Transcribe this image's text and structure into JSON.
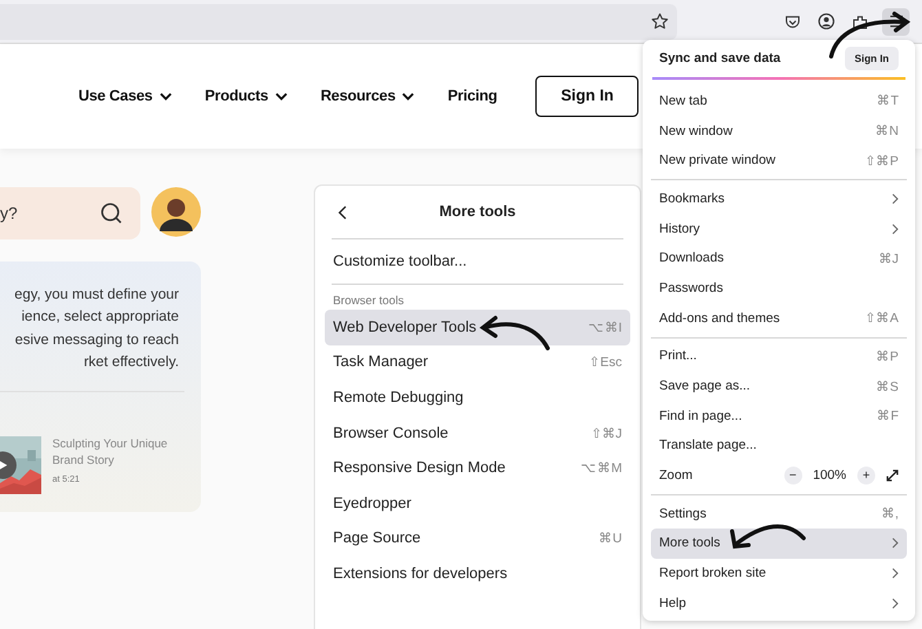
{
  "site_nav": {
    "links": [
      {
        "label": "Use Cases",
        "dropdown": true
      },
      {
        "label": "Products",
        "dropdown": true
      },
      {
        "label": "Resources",
        "dropdown": true
      },
      {
        "label": "Pricing",
        "dropdown": false
      }
    ],
    "sign_in": "Sign In"
  },
  "search": {
    "value": "y?"
  },
  "card": {
    "text": "egy, you must define your\nience, select appropriate\nesive messaging to reach\nrket effectively.",
    "video": {
      "title": "Sculpting Your Unique\nBrand Story",
      "time": "at 5:21"
    }
  },
  "more_tools": {
    "title": "More tools",
    "customize": "Customize toolbar...",
    "section": "Browser tools",
    "items": [
      {
        "label": "Web Developer Tools",
        "shortcut": "⌥⌘I",
        "selected": true
      },
      {
        "label": "Task Manager",
        "shortcut": "⇧Esc",
        "selected": false
      },
      {
        "label": "Remote Debugging",
        "selected": false
      },
      {
        "label": "Browser Console",
        "shortcut": "⇧⌘J",
        "selected": false
      },
      {
        "label": "Responsive Design Mode",
        "shortcut": "⌥⌘M",
        "selected": false
      },
      {
        "label": "Eyedropper",
        "selected": false
      },
      {
        "label": "Page Source",
        "shortcut": "⌘U",
        "selected": false
      },
      {
        "label": "Extensions for developers",
        "selected": false
      }
    ]
  },
  "app_menu": {
    "sync": {
      "title": "Sync and save data",
      "button": "Sign In"
    },
    "groups": [
      [
        {
          "kind": "item",
          "label": "New tab",
          "shortcut": "⌘T",
          "selected": false
        },
        {
          "kind": "item",
          "label": "New window",
          "shortcut": "⌘N",
          "selected": false
        },
        {
          "kind": "item",
          "label": "New private window",
          "shortcut": "⇧⌘P",
          "selected": false
        }
      ],
      [
        {
          "kind": "submenu",
          "label": "Bookmarks",
          "selected": false
        },
        {
          "kind": "submenu",
          "label": "History",
          "selected": false
        },
        {
          "kind": "item",
          "label": "Downloads",
          "shortcut": "⌘J",
          "selected": false
        },
        {
          "kind": "item",
          "label": "Passwords",
          "selected": false
        },
        {
          "kind": "item",
          "label": "Add-ons and themes",
          "shortcut": "⇧⌘A",
          "selected": false
        }
      ],
      [
        {
          "kind": "item",
          "label": "Print...",
          "shortcut": "⌘P",
          "selected": false
        },
        {
          "kind": "item",
          "label": "Save page as...",
          "shortcut": "⌘S",
          "selected": false
        },
        {
          "kind": "item",
          "label": "Find in page...",
          "shortcut": "⌘F",
          "selected": false
        },
        {
          "kind": "item",
          "label": "Translate page...",
          "selected": false
        },
        {
          "kind": "zoom",
          "label": "Zoom",
          "minus": "−",
          "value": "100%",
          "plus": "+",
          "selected": false
        }
      ],
      [
        {
          "kind": "item",
          "label": "Settings",
          "shortcut": "⌘,",
          "selected": false
        },
        {
          "kind": "submenu",
          "label": "More tools",
          "selected": true
        },
        {
          "kind": "submenu",
          "label": "Report broken site",
          "selected": false
        },
        {
          "kind": "submenu",
          "label": "Help",
          "selected": false
        }
      ]
    ]
  }
}
